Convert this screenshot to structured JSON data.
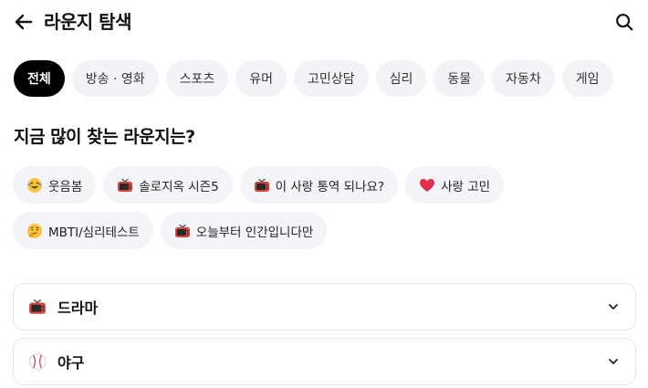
{
  "header": {
    "title": "라운지 탐색",
    "back_icon": "arrow-left-icon",
    "search_icon": "search-icon"
  },
  "tabs": [
    {
      "label": "전체",
      "active": true
    },
    {
      "label": "방송 · 영화",
      "active": false
    },
    {
      "label": "스포츠",
      "active": false
    },
    {
      "label": "유머",
      "active": false
    },
    {
      "label": "고민상담",
      "active": false
    },
    {
      "label": "심리",
      "active": false
    },
    {
      "label": "동물",
      "active": false
    },
    {
      "label": "자동차",
      "active": false
    },
    {
      "label": "게임",
      "active": false
    }
  ],
  "popular": {
    "title": "지금 많이 찾는 라운지는?",
    "chips": [
      {
        "icon": "laughing-face-icon",
        "label": "웃음봄"
      },
      {
        "icon": "tv-icon",
        "label": "솔로지옥 시즌5"
      },
      {
        "icon": "tv-icon",
        "label": "이 사랑 통역 되나요?"
      },
      {
        "icon": "heart-icon",
        "label": "사랑 고민"
      },
      {
        "icon": "thinking-face-icon",
        "label": "MBTI/심리테스트"
      },
      {
        "icon": "tv-icon",
        "label": "오늘부터 인간입니다만"
      }
    ]
  },
  "accordions": [
    {
      "icon": "tv-icon",
      "label": "드라마"
    },
    {
      "icon": "baseball-icon",
      "label": "야구"
    }
  ],
  "colors": {
    "active_tab_bg": "#000000",
    "chip_bg": "#f3f4f7",
    "tv_red": "#d9453c",
    "heart_red": "#e0304a",
    "emoji_yellow": "#f8c43b"
  }
}
